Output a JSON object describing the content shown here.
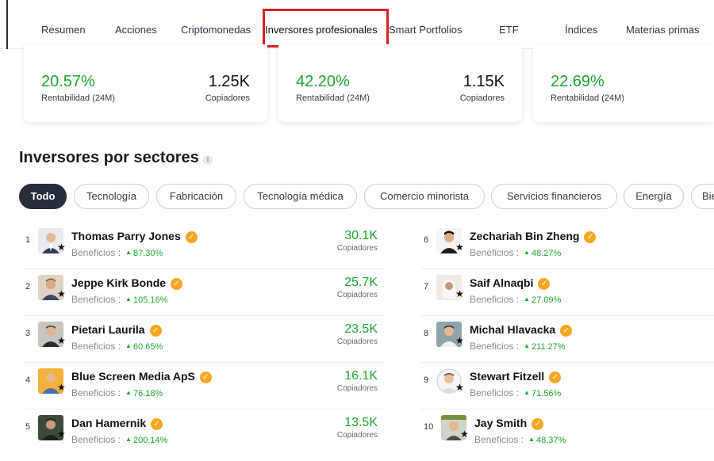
{
  "nav": {
    "tabs": [
      "Resumen",
      "Acciones",
      "Criptomonedas",
      "Inversores profesionales",
      "Smart Portfolios",
      "ETF",
      "Índices",
      "Materias primas"
    ]
  },
  "cards": [
    {
      "pct": "20.57%",
      "pct_label": "Rentabilidad (24M)",
      "copiers": "1.25K",
      "copiers_label": "Copiadores"
    },
    {
      "pct": "42.20%",
      "pct_label": "Rentabilidad (24M)",
      "copiers": "1.15K",
      "copiers_label": "Copiadores"
    },
    {
      "pct": "22.69%",
      "pct_label": "Rentabilidad (24M)"
    }
  ],
  "section": {
    "title": "Inversores por sectores",
    "info": "i"
  },
  "filters": [
    "Todo",
    "Tecnología",
    "Fabricación",
    "Tecnología médica",
    "Comercio minorista",
    "Servicios financieros",
    "Energía",
    "Bie"
  ],
  "benefit_label": "Beneficios :",
  "copiers_label": "Copiadores",
  "investors_left": [
    {
      "rank": "1",
      "name": "Thomas Parry Jones",
      "benefit": "87.30%",
      "copiers": "30.1K"
    },
    {
      "rank": "2",
      "name": "Jeppe Kirk Bonde",
      "benefit": "105.16%",
      "copiers": "25.7K"
    },
    {
      "rank": "3",
      "name": "Pietari Laurila",
      "benefit": "60.65%",
      "copiers": "23.5K"
    },
    {
      "rank": "4",
      "name": "Blue Screen Media ApS",
      "benefit": "76.18%",
      "copiers": "16.1K"
    },
    {
      "rank": "5",
      "name": "Dan Hamernik",
      "benefit": "200.14%",
      "copiers": "13.5K"
    }
  ],
  "investors_right": [
    {
      "rank": "6",
      "name": "Zechariah Bin Zheng",
      "benefit": "48.27%"
    },
    {
      "rank": "7",
      "name": "Saif Alnaqbi",
      "benefit": "27.09%"
    },
    {
      "rank": "8",
      "name": "Michal Hlavacka",
      "benefit": "211.27%"
    },
    {
      "rank": "9",
      "name": "Stewart Fitzell",
      "benefit": "71.56%"
    },
    {
      "rank": "10",
      "name": "Jay Smith",
      "benefit": "48.37%"
    }
  ],
  "colors": {
    "accent_green": "#1fa531",
    "highlight_red": "#d61f26",
    "chip_active": "#262d3b",
    "verified_badge": "#f5a623"
  }
}
